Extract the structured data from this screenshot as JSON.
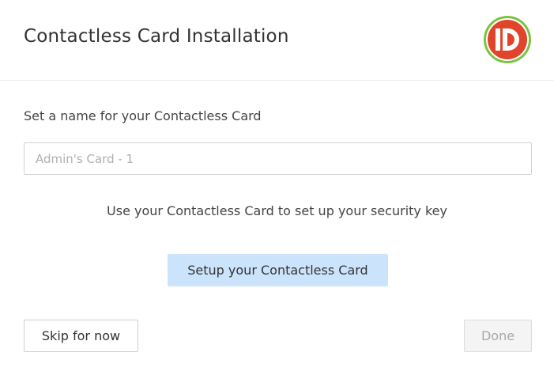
{
  "dialog": {
    "title": "Contactless Card Installation",
    "logo_icon": "id-logo-icon",
    "logo_text": "ID"
  },
  "form": {
    "name_label": "Set a name for your Contactless Card",
    "name_value": "",
    "name_placeholder": "Admin's Card - 1",
    "instruction": "Use your Contactless Card to set up your security key",
    "setup_label": "Setup your Contactless Card"
  },
  "footer": {
    "skip_label": "Skip for now",
    "done_label": "Done"
  },
  "colors": {
    "logo_red": "#e0452b",
    "logo_green": "#7cc242",
    "setup_button_bg": "#cce4fb",
    "done_disabled_bg": "#f4f4f4"
  }
}
